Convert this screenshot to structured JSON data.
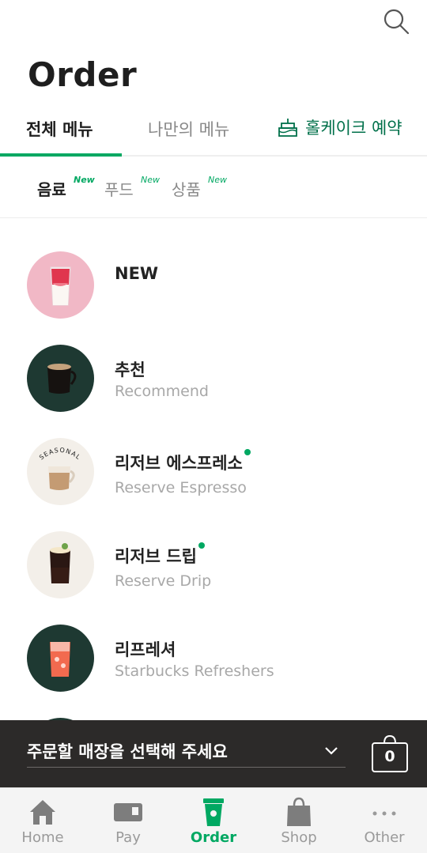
{
  "header": {
    "title": "Order",
    "search_icon": "search-icon"
  },
  "tabs": [
    {
      "label": "전체 메뉴",
      "active": true
    },
    {
      "label": "나만의 메뉴",
      "active": false
    },
    {
      "label": "홀케이크 예약",
      "active": false,
      "icon": "cake-icon"
    }
  ],
  "subtabs": [
    {
      "label": "음료",
      "badge": "New",
      "active": true
    },
    {
      "label": "푸드",
      "badge": "New",
      "active": false
    },
    {
      "label": "상품",
      "badge": "New",
      "active": false
    }
  ],
  "menu": [
    {
      "title": "NEW",
      "subtitle": "",
      "has_new_dot": false
    },
    {
      "title": "추천",
      "subtitle": "Recommend",
      "has_new_dot": false
    },
    {
      "title": "리저브 에스프레소",
      "subtitle": "Reserve Espresso",
      "has_new_dot": true,
      "thumb_label": "SEASONAL"
    },
    {
      "title": "리저브 드립",
      "subtitle": "Reserve Drip",
      "has_new_dot": true
    },
    {
      "title": "리프레셔",
      "subtitle": "Starbucks Refreshers",
      "has_new_dot": false
    }
  ],
  "store_bar": {
    "placeholder": "주문할 매장을 선택해 주세요",
    "cart_count": "0"
  },
  "bottom_nav": [
    {
      "label": "Home",
      "icon": "home-icon",
      "active": false
    },
    {
      "label": "Pay",
      "icon": "pay-card-icon",
      "active": false
    },
    {
      "label": "Order",
      "icon": "order-cup-icon",
      "active": true
    },
    {
      "label": "Shop",
      "icon": "shop-bag-icon",
      "active": false
    },
    {
      "label": "Other",
      "icon": "more-dots-icon",
      "active": false
    }
  ],
  "colors": {
    "accent_green": "#00a862",
    "brand_green": "#00704a",
    "store_bar_bg": "#2c2a29",
    "thumb_dark_green": "#1e3932",
    "thumb_pink": "#f1b8c6",
    "thumb_cream": "#f3efe9"
  }
}
